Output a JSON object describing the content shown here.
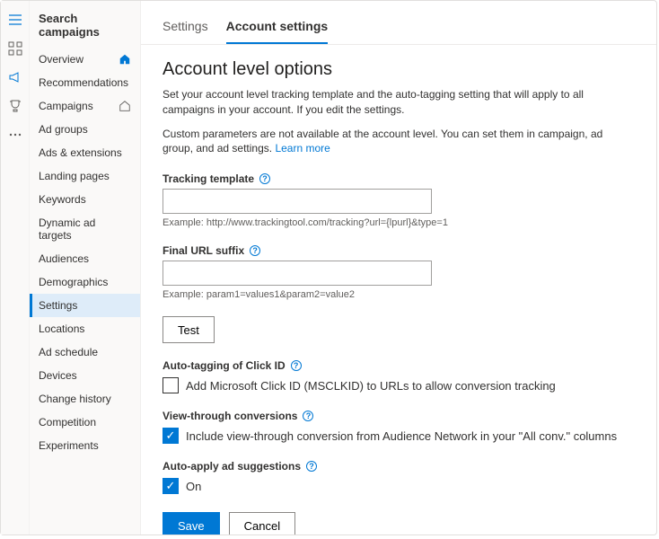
{
  "sidebar": {
    "title": "Search campaigns",
    "items": [
      {
        "label": "Overview",
        "icon": "home"
      },
      {
        "label": "Recommendations"
      },
      {
        "label": "Campaigns",
        "icon": "home-outline"
      },
      {
        "label": "Ad groups"
      },
      {
        "label": "Ads & extensions"
      },
      {
        "label": "Landing pages"
      },
      {
        "label": "Keywords"
      },
      {
        "label": "Dynamic ad targets"
      },
      {
        "label": "Audiences"
      },
      {
        "label": "Demographics"
      },
      {
        "label": "Settings",
        "selected": true
      },
      {
        "label": "Locations"
      },
      {
        "label": "Ad schedule"
      },
      {
        "label": "Devices"
      },
      {
        "label": "Change history"
      },
      {
        "label": "Competition"
      },
      {
        "label": "Experiments"
      }
    ]
  },
  "tabs": {
    "settings": "Settings",
    "account_settings": "Account settings"
  },
  "page": {
    "title": "Account level options",
    "desc1": "Set your account level tracking template and the auto-tagging setting that will apply to all campaigns in your account. If you edit the settings.",
    "desc2": "Custom parameters are not available at the account level. You can set them in campaign, ad group, and ad settings.",
    "learn_more": "Learn more"
  },
  "tracking": {
    "label": "Tracking template",
    "value": "",
    "example": "Example: http://www.trackingtool.com/tracking?url={lpurl}&type=1"
  },
  "suffix": {
    "label": "Final URL suffix",
    "value": "",
    "example": "Example: param1=values1&param2=value2"
  },
  "buttons": {
    "test": "Test",
    "save": "Save",
    "cancel": "Cancel"
  },
  "autotag": {
    "label": "Auto-tagging of Click ID",
    "checkbox_label": "Add Microsoft Click ID (MSCLKID) to URLs to allow conversion tracking",
    "checked": false
  },
  "viewthrough": {
    "label": "View-through conversions",
    "checkbox_label": "Include view-through conversion from Audience Network in your \"All conv.\" columns",
    "checked": true
  },
  "autoapply": {
    "label": "Auto-apply ad suggestions",
    "checkbox_label": "On",
    "checked": true
  }
}
